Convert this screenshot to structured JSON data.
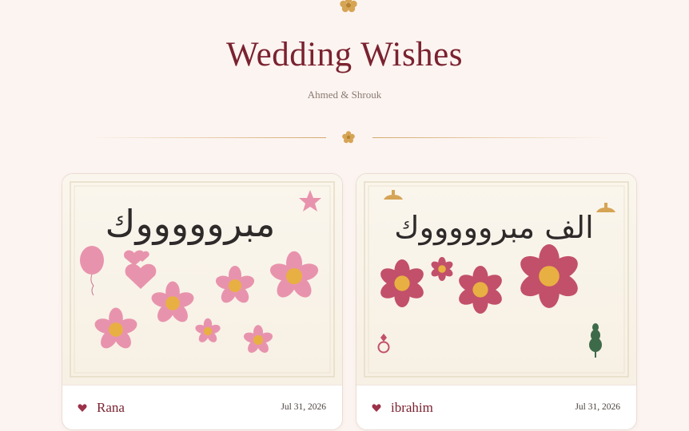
{
  "header": {
    "title": "Wedding Wishes",
    "subtitle": "Ahmed & Shrouk"
  },
  "cards": [
    {
      "handwriting": "مبروووووك",
      "sender": "Rana",
      "date": "Jul 31, 2026"
    },
    {
      "handwriting": "الف مبروووووك",
      "sender": "ibrahim",
      "date": "Jul 31, 2026"
    }
  ],
  "colors": {
    "title": "#7a2230",
    "gold": "#d4a96e",
    "pink_flower": "#e893ad",
    "red_flower": "#c2506a",
    "flower_center": "#e8b042",
    "background": "#fcf4f0"
  }
}
